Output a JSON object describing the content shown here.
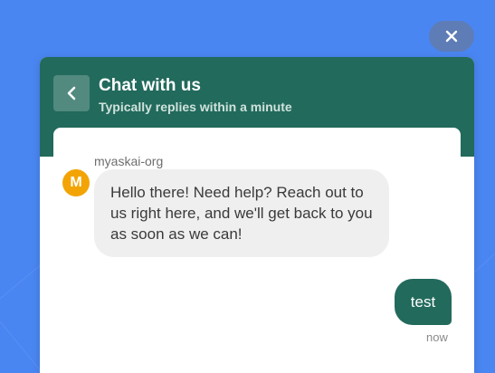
{
  "colors": {
    "page_background": "#4a86f2",
    "header_background": "#226a5c",
    "user_bubble": "#226a5c",
    "bot_bubble": "#efefef",
    "avatar": "#f2a405",
    "close_button": "#5e7cb6"
  },
  "close_button": {
    "icon": "close-icon"
  },
  "header": {
    "back_icon": "chevron-left-icon",
    "title": "Chat with us",
    "subtitle": "Typically replies within a minute"
  },
  "conversation": {
    "bot_message": {
      "sender": "myaskai-org",
      "avatar_letter": "M",
      "text": "Hello there! Need help? Reach out to us right here, and we'll get back to you as soon as we can!"
    },
    "user_message": {
      "text": "test",
      "timestamp": "now"
    }
  }
}
